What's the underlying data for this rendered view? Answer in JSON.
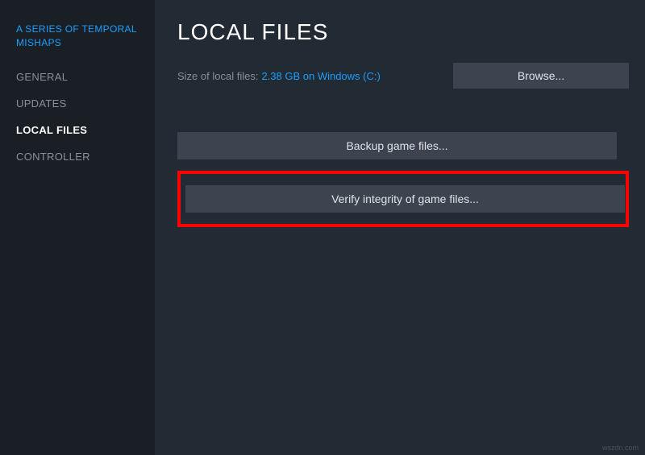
{
  "close_icon": "close-icon",
  "sidebar": {
    "game_title": "A SERIES OF TEMPORAL MISHAPS",
    "items": [
      {
        "label": "GENERAL",
        "active": false
      },
      {
        "label": "UPDATES",
        "active": false
      },
      {
        "label": "LOCAL FILES",
        "active": true
      },
      {
        "label": "CONTROLLER",
        "active": false
      }
    ]
  },
  "main": {
    "page_title": "LOCAL FILES",
    "size_label": "Size of local files:",
    "size_value": "2.38 GB on Windows (C:)",
    "browse_label": "Browse...",
    "backup_label": "Backup game files...",
    "verify_label": "Verify integrity of game files..."
  },
  "watermark": "wszdn.com"
}
